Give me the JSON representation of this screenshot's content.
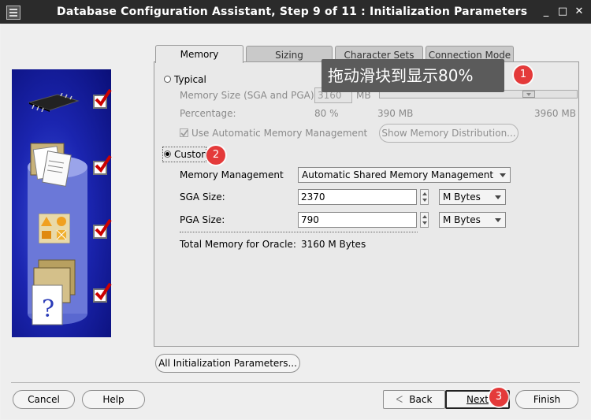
{
  "window": {
    "title": "Database Configuration Assistant, Step 9 of 11 : Initialization Parameters",
    "controls": [
      "_",
      "□",
      "✕"
    ]
  },
  "tabs": [
    {
      "label": "Memory",
      "active": true
    },
    {
      "label": "Sizing",
      "active": false
    },
    {
      "label": "Character Sets",
      "active": false
    },
    {
      "label": "Connection Mode",
      "active": false
    }
  ],
  "typical": {
    "label": "Typical",
    "memory_size_label": "Memory Size (SGA and PGA):",
    "memory_size_value": "3160",
    "memory_size_unit": "MB",
    "percentage_label": "Percentage:",
    "percentage_value": "80 %",
    "slider_min": "390 MB",
    "slider_max": "3960 MB",
    "slider_fraction": 0.8,
    "auto_mem_label": "Use Automatic Memory Management",
    "show_distribution_button": "Show Memory Distribution..."
  },
  "custom": {
    "label": "Custom",
    "memory_management_label": "Memory Management",
    "memory_management_value": "Automatic Shared Memory Management",
    "sga_label": "SGA Size:",
    "sga_value": "2370",
    "sga_unit": "M Bytes",
    "pga_label": "PGA Size:",
    "pga_value": "790",
    "pga_unit": "M Bytes",
    "total_label": "Total Memory for Oracle:",
    "total_value": "3160 M Bytes"
  },
  "all_params_button": "All Initialization Parameters...",
  "footer": {
    "cancel": "Cancel",
    "help": "Help",
    "back": "Back",
    "next": "Next",
    "finish": "Finish"
  },
  "annotations": {
    "tooltip": "拖动滑块到显示80%",
    "badge1": "1",
    "badge2": "2",
    "badge3": "3"
  },
  "colors": {
    "title_bar": "#2b2b2b",
    "side_panel": "#1b25b0",
    "check_mark": "#cc0000",
    "badge": "#e43a3a",
    "tooltip": "#5b5b5b"
  }
}
